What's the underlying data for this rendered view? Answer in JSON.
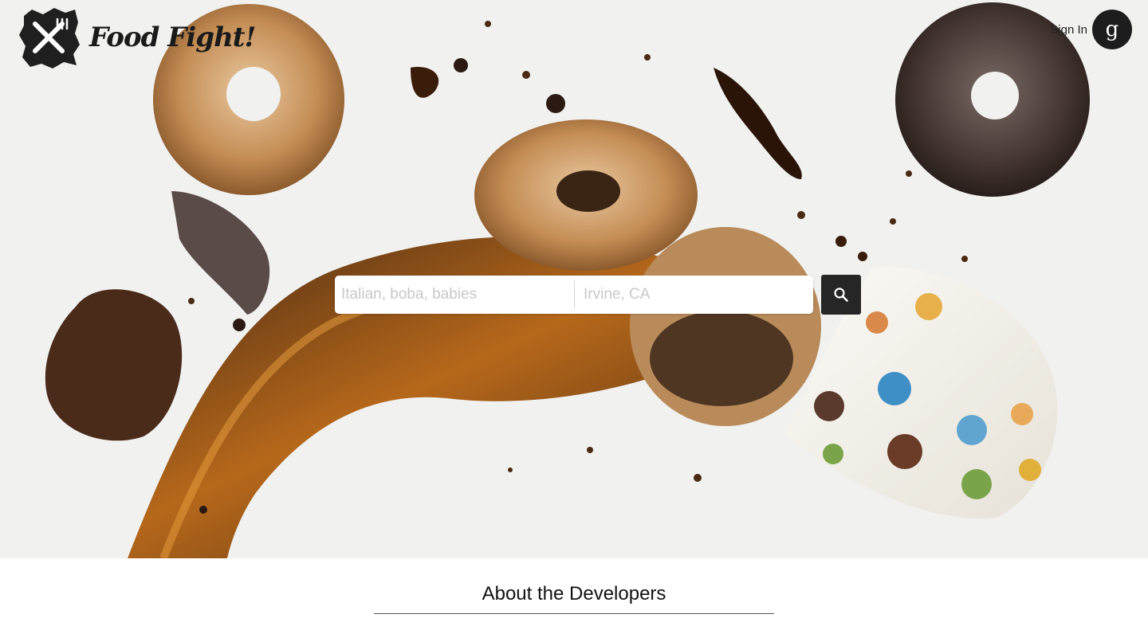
{
  "header": {
    "brand_name": "Food Fight!",
    "logo_icon": "crossed-fork-knife-icon",
    "sign_in_label": "Sign In",
    "google_icon_glyph": "g"
  },
  "search": {
    "term_placeholder": "Italian, boba, babies",
    "location_placeholder": "Irvine, CA",
    "button_icon": "search-icon"
  },
  "about": {
    "title": "About the Developers"
  },
  "colors": {
    "hero_background": "#f1f1f0",
    "search_button": "#262626",
    "text_dark": "#111111"
  }
}
